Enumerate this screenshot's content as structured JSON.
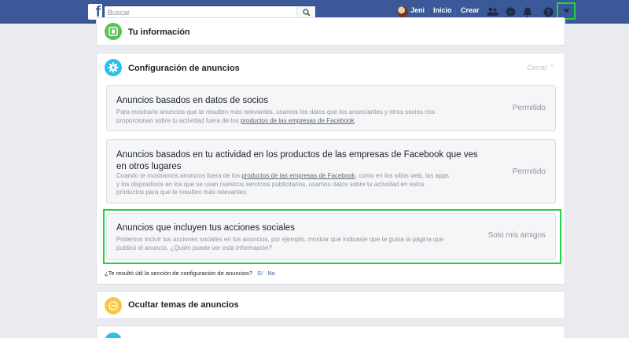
{
  "topbar": {
    "logo": "f",
    "search_placeholder": "Buscar",
    "user_name": "Jeni",
    "home_label": "Inicio",
    "create_label": "Crear"
  },
  "sections": {
    "your_info": {
      "title": "Tu información",
      "color": "#5bbf5a"
    },
    "ad_settings": {
      "title": "Configuración de anuncios",
      "close_label": "Cerrar",
      "color": "#2cc0e8",
      "items": [
        {
          "title": "Anuncios basados en datos de socios",
          "desc_before": "Para mostrarte anuncios que te resulten más relevantes, usamos los datos que los anunciantes y otros socios nos proporcionan sobre tu actividad fuera de los ",
          "desc_link": "productos de las empresas de Facebook",
          "desc_after": ".",
          "status": "Permitido"
        },
        {
          "title": "Anuncios basados en tu actividad en los productos de las empresas de Facebook que ves en otros lugares",
          "desc_before": "Cuando te mostramos anuncios fuera de los ",
          "desc_link": "productos de las empresas de Facebook",
          "desc_after": ", como en los sitios web, las apps y los dispositivos en los que se usan nuestros servicios publicitarios, usamos datos sobre tu actividad en estos productos para que te resulten más relevantes.",
          "status": "Permitido"
        },
        {
          "title": "Anuncios que incluyen tus acciones sociales",
          "desc": "Podemos incluir tus acciones sociales en los anuncios, por ejemplo, mostrar que indicaste que te gusta la página que publicó el anuncio. ¿Quién puede ver esta información?",
          "status": "Solo mis amigos"
        }
      ],
      "feedback_question": "¿Te resultó útil la sección de configuración de anuncios?",
      "feedback_yes": "Sí",
      "feedback_no": "No"
    },
    "hide_topics": {
      "title": "Ocultar temas de anuncios",
      "color": "#f7c744"
    }
  },
  "colors": {
    "topbar": "#3b5998",
    "highlight": "#1fd33d",
    "page_bg": "#e9ebee"
  }
}
